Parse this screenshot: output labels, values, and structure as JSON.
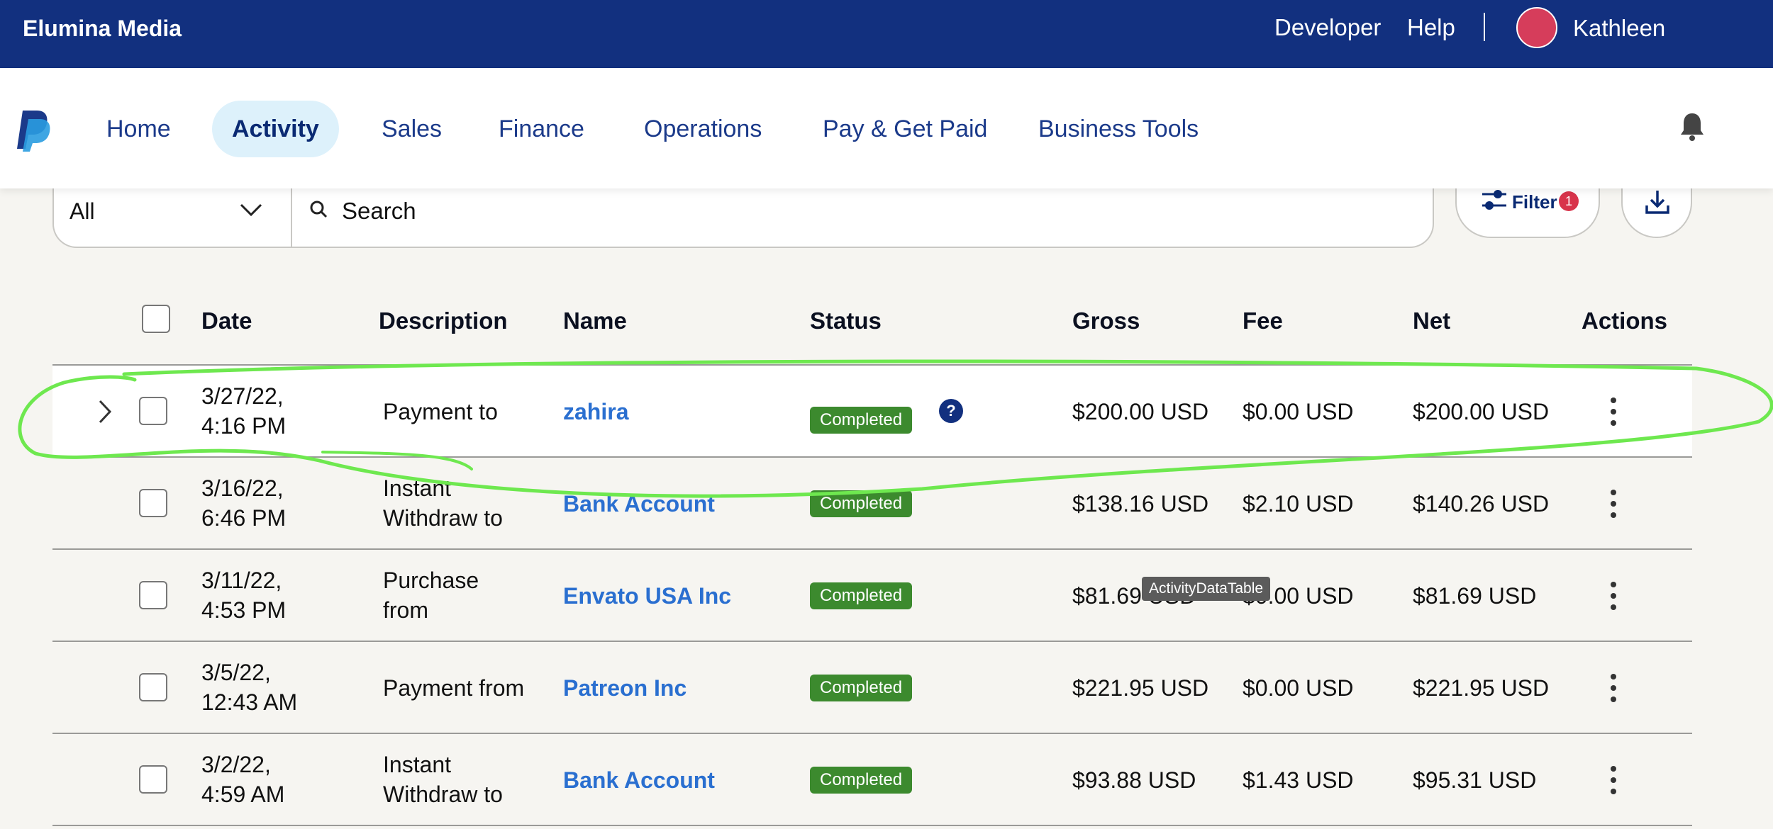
{
  "topbar": {
    "brand": "Elumina Media",
    "links": [
      "Developer",
      "Help"
    ],
    "user_name": "Kathleen",
    "avatar_color": "#d63d5b"
  },
  "nav": {
    "items": [
      "Home",
      "Activity",
      "Sales",
      "Finance",
      "Operations",
      "Pay & Get Paid",
      "Business Tools"
    ],
    "active": "Activity"
  },
  "toolbar": {
    "type_select": "All",
    "search_placeholder": "Search",
    "filter_label": "Filter",
    "filter_count": "1"
  },
  "table": {
    "headers": {
      "date": "Date",
      "description": "Description",
      "name": "Name",
      "status": "Status",
      "gross": "Gross",
      "fee": "Fee",
      "net": "Net",
      "actions": "Actions"
    },
    "rows": [
      {
        "date_line1": "3/27/22,",
        "date_line2": "4:16 PM",
        "desc_line1": "Payment to",
        "desc_line2": "",
        "name": "zahira",
        "status": "Completed",
        "gross": "$200.00 USD",
        "fee": "$0.00 USD",
        "net": "$200.00 USD"
      },
      {
        "date_line1": "3/16/22,",
        "date_line2": "6:46 PM",
        "desc_line1": "Instant",
        "desc_line2": "Withdraw to",
        "name": "Bank Account",
        "status": "Completed",
        "gross": "$138.16 USD",
        "fee": "$2.10 USD",
        "net": "$140.26 USD"
      },
      {
        "date_line1": "3/11/22,",
        "date_line2": "4:53 PM",
        "desc_line1": "Purchase",
        "desc_line2": "from",
        "name": "Envato USA Inc",
        "status": "Completed",
        "gross": "$81.69 USD",
        "fee": "$0.00 USD",
        "net": "$81.69 USD"
      },
      {
        "date_line1": "3/5/22,",
        "date_line2": "12:43 AM",
        "desc_line1": "Payment from",
        "desc_line2": "",
        "name": "Patreon Inc",
        "status": "Completed",
        "gross": "$221.95 USD",
        "fee": "$0.00 USD",
        "net": "$221.95 USD"
      },
      {
        "date_line1": "3/2/22,",
        "date_line2": "4:59 AM",
        "desc_line1": "Instant",
        "desc_line2": "Withdraw to",
        "name": "Bank Account",
        "status": "Completed",
        "gross": "$93.88 USD",
        "fee": "$1.43 USD",
        "net": "$95.31 USD"
      }
    ]
  },
  "tooltip": "ActivityDataTable",
  "help_icon": "?",
  "colors": {
    "brand_blue": "#12307f",
    "link_blue": "#2a6fd0",
    "status_green": "#3c8a2e",
    "highlight_green": "#6ee84f",
    "badge_red": "#d8344b"
  }
}
